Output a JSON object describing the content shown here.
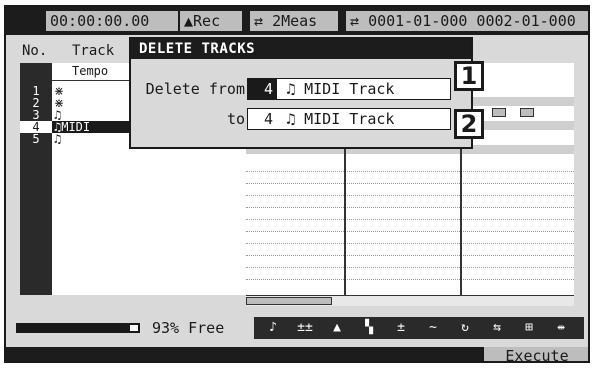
{
  "status_bar": {
    "time": "00:00:00.00",
    "rec": "Rec",
    "loop_meas": "2Meas",
    "loop_range": "0001-01-000  0002-01-000"
  },
  "track_list": {
    "col_no": "No.",
    "col_track": "Track",
    "tempo_label": "Tempo",
    "rows": [
      {
        "num": "1",
        "icon": "audio",
        "name": "",
        "selected": false
      },
      {
        "num": "2",
        "icon": "audio",
        "name": "",
        "selected": false
      },
      {
        "num": "3",
        "icon": "midi",
        "name": "",
        "selected": false
      },
      {
        "num": "4",
        "icon": "midi",
        "name": "MIDI",
        "selected": true
      },
      {
        "num": "5",
        "icon": "midi",
        "name": "---",
        "selected": false
      }
    ]
  },
  "dialog": {
    "title": "DELETE TRACKS",
    "from_label": "Delete from",
    "from_value_num": "4",
    "from_value_name": "♫ MIDI Track",
    "to_label": "to",
    "to_value_num": "4",
    "to_value_name": "♫ MIDI Track"
  },
  "callouts": [
    "1",
    "2"
  ],
  "bottom": {
    "memory_free_fraction": 0.93,
    "free_text": "93% Free",
    "tools": [
      "note-icon",
      "quantize-icon",
      "velocity-icon",
      "step-icon",
      "transpose-icon",
      "curve-icon",
      "loop-icon",
      "swap-icon",
      "grid-icon",
      "expand-icon"
    ],
    "tool_glyphs": [
      "♪",
      "±±",
      "▲",
      "▚",
      "±",
      "∼",
      "↻",
      "⇆",
      "⊞",
      "⇹"
    ]
  },
  "func_bar": {
    "execute_label": "Execute"
  }
}
